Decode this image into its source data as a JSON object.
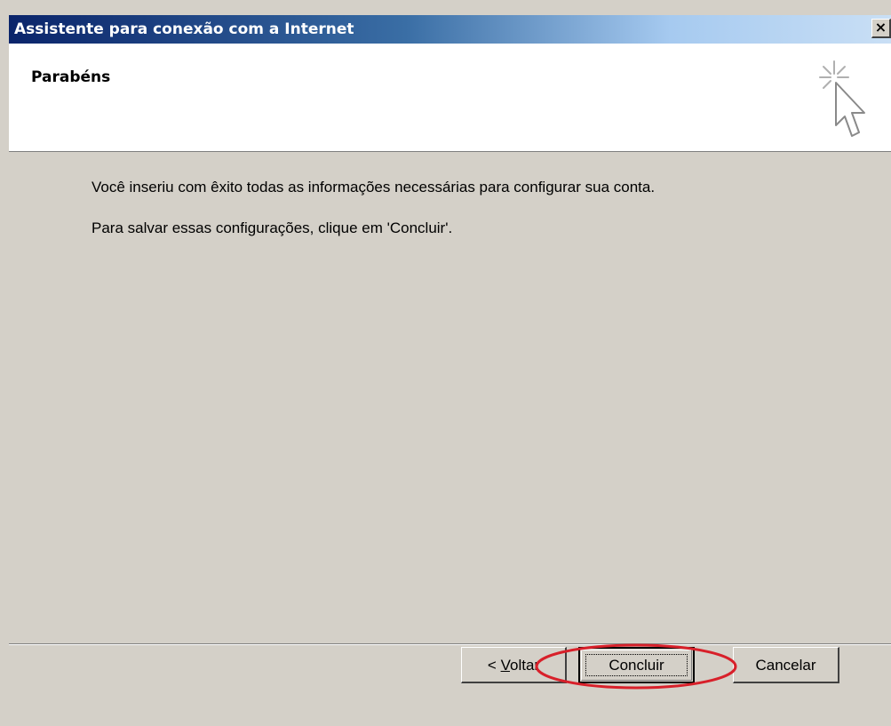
{
  "window": {
    "title": "Assistente para conexão com a Internet",
    "close_glyph": "×"
  },
  "header": {
    "title": "Parabéns",
    "icon": "wizard-cursor-sparkle-icon"
  },
  "body": {
    "line1": "Você inseriu com êxito todas as informações necessárias para configurar sua conta.",
    "line2": "Para salvar essas configurações, clique em 'Concluir'."
  },
  "buttons": {
    "back_prefix": "< ",
    "back_mnemonic": "V",
    "back_rest": "oltar",
    "finish": "Concluir",
    "cancel": "Cancelar"
  },
  "annotation": {
    "highlight_color": "#d8202a",
    "highlight_target": "Concluir"
  },
  "colors": {
    "titlebar_start": "#0a246a",
    "titlebar_end": "#c9dff5",
    "dialog_bg": "#d4d0c8"
  }
}
